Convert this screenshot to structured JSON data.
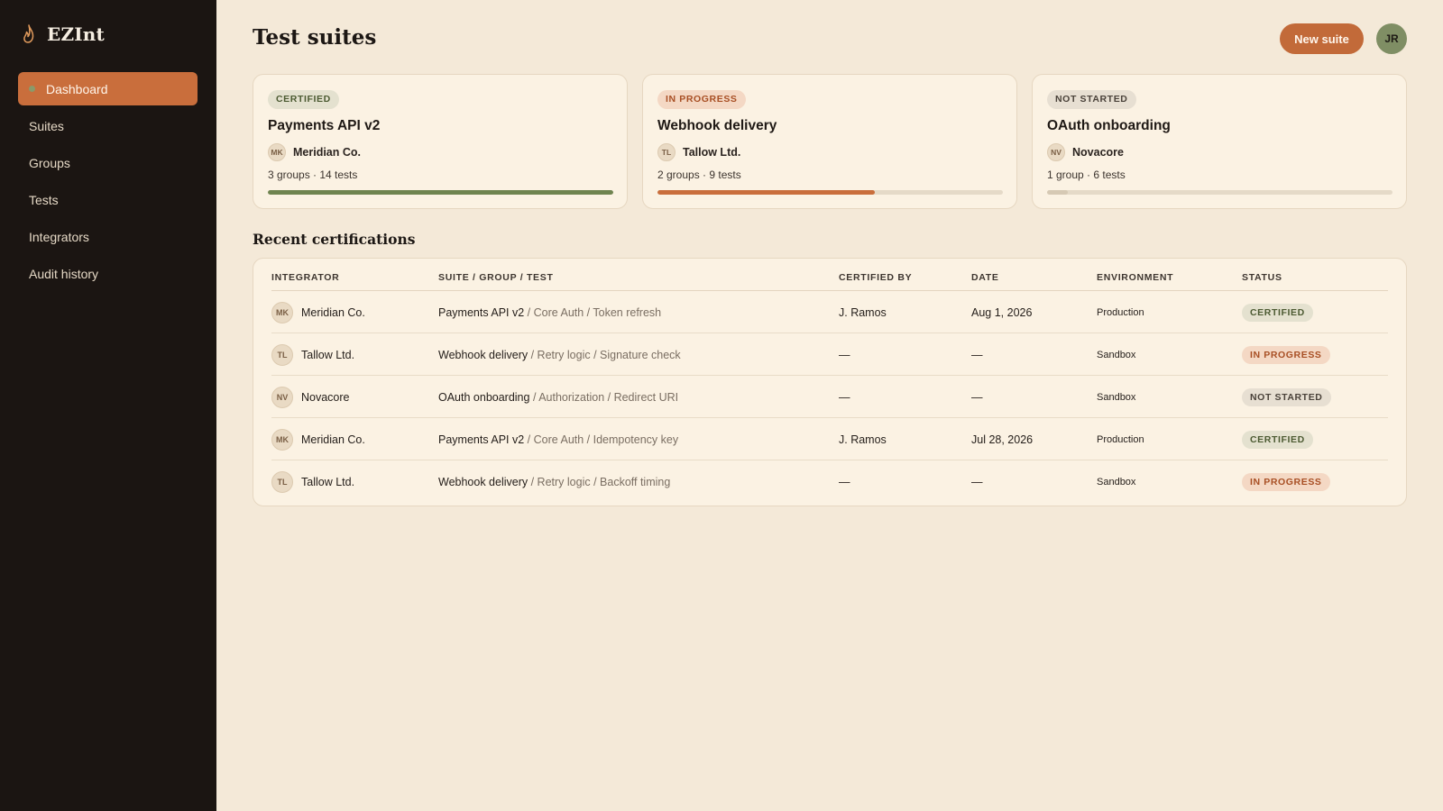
{
  "app": {
    "name": "EZInt"
  },
  "sidebar": {
    "items": [
      {
        "label": "Dashboard",
        "active": true
      },
      {
        "label": "Suites"
      },
      {
        "label": "Groups"
      },
      {
        "label": "Tests"
      },
      {
        "label": "Integrators"
      },
      {
        "label": "Audit history"
      }
    ]
  },
  "header": {
    "title": "Test suites",
    "new_suite_label": "New suite",
    "user_initials": "JR"
  },
  "cards": [
    {
      "status": "CERTIFIED",
      "title": "Payments API v2",
      "org_initials": "MK",
      "org": "Meridian Co.",
      "meta": "3 groups · 14 tests",
      "progress_percent": 100,
      "bar_color": "#6f8450"
    },
    {
      "status": "IN PROGRESS",
      "title": "Webhook delivery",
      "org_initials": "TL",
      "org": "Tallow Ltd.",
      "meta": "2 groups · 9 tests",
      "progress_percent": 63,
      "bar_color": "#c96e3c"
    },
    {
      "status": "NOT STARTED",
      "title": "OAuth onboarding",
      "org_initials": "NV",
      "org": "Novacore",
      "meta": "1 group · 6 tests",
      "progress_percent": 6,
      "bar_color": "#d6c9b4"
    }
  ],
  "recent": {
    "title": "Recent certifications",
    "columns": [
      "INTEGRATOR",
      "SUITE / GROUP / TEST",
      "CERTIFIED BY",
      "DATE",
      "ENVIRONMENT",
      "STATUS"
    ],
    "rows": [
      {
        "initials": "MK",
        "integrator": "Meridian Co.",
        "suite": "Payments API v2",
        "path": " / Core Auth / Token refresh",
        "certified_by": "J. Ramos",
        "date": "Aug 1, 2026",
        "environment": "Production",
        "status": "CERTIFIED"
      },
      {
        "initials": "TL",
        "integrator": "Tallow Ltd.",
        "suite": "Webhook delivery",
        "path": " / Retry logic / Signature check",
        "certified_by": "—",
        "date": "—",
        "environment": "Sandbox",
        "status": "IN PROGRESS"
      },
      {
        "initials": "NV",
        "integrator": "Novacore",
        "suite": "OAuth onboarding",
        "path": " / Authorization / Redirect URI",
        "certified_by": "—",
        "date": "—",
        "environment": "Sandbox",
        "status": "NOT STARTED"
      },
      {
        "initials": "MK",
        "integrator": "Meridian Co.",
        "suite": "Payments API v2",
        "path": " / Core Auth / Idempotency key",
        "certified_by": "J. Ramos",
        "date": "Jul 28, 2026",
        "environment": "Production",
        "status": "CERTIFIED"
      },
      {
        "initials": "TL",
        "integrator": "Tallow Ltd.",
        "suite": "Webhook delivery",
        "path": " / Retry logic / Backoff timing",
        "certified_by": "—",
        "date": "—",
        "environment": "Sandbox",
        "status": "IN PROGRESS"
      }
    ]
  },
  "colors": {
    "accent": "#c96e3c",
    "sidebar_bg": "#1b1512",
    "page_bg": "#f4e9d8",
    "certified": "#6f8450"
  },
  "icons": {
    "brand": "flame-icon"
  }
}
